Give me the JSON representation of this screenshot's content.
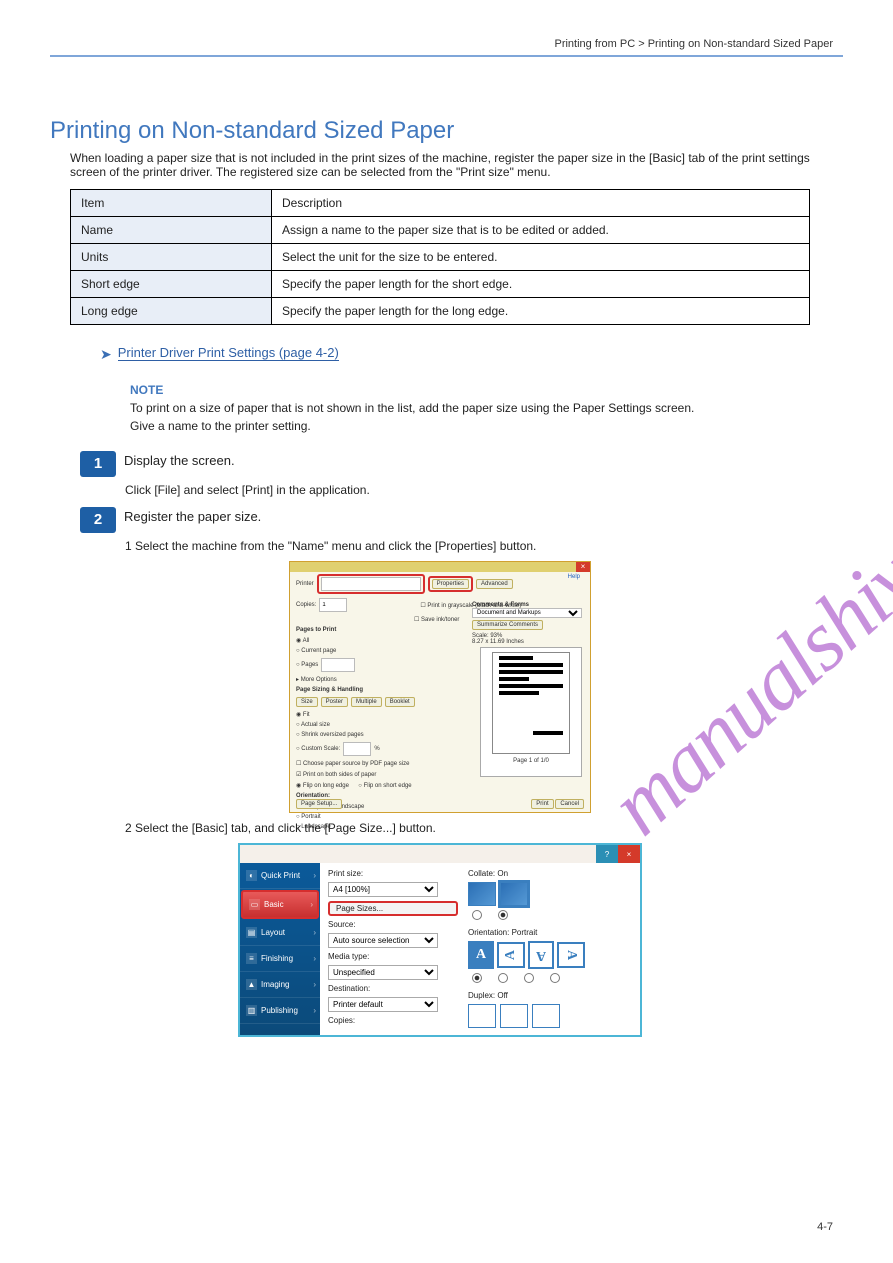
{
  "header_right": "Printing from PC > Printing on Non-standard Sized Paper",
  "page_number": "4-7",
  "title": "Printing on Non-standard Sized Paper",
  "subtitle": "When loading a paper size that is not included in the print sizes of the machine, register the paper size in the [Basic] tab of the print settings screen of the printer driver.\nThe registered size can be selected from the \"Print size\" menu.",
  "table": {
    "rows": [
      {
        "label": "Item",
        "value": "Description"
      },
      {
        "label": "Name",
        "value": "Assign a name to the paper size that is to be edited or added."
      },
      {
        "label": "Units",
        "value": "Select the unit for the size to be entered."
      },
      {
        "label": "Short edge",
        "value": "Specify the paper length for the short edge."
      },
      {
        "label": "Long edge",
        "value": "Specify the paper length for the long edge."
      }
    ]
  },
  "link": {
    "text": "Printer Driver Print Settings (page 4-2)"
  },
  "note": {
    "title": "NOTE",
    "l1": "To print on a size of paper that is not shown in the list, add the paper size using the Paper Settings screen.",
    "l2": "Give a name to the printer setting."
  },
  "steps": {
    "s1": {
      "text": "Display the screen."
    },
    "s1_sub": "Click [File] and select [Print] in the application.",
    "s2": {
      "text": "Register the paper size."
    },
    "s2_sub1": "1   Select the machine from the \"Name\" menu and click the [Properties] button.",
    "s2_sub2": "2   Select the [Basic] tab, and click the [Page Size...] button."
  },
  "dlg1": {
    "printer_lbl": "Printer",
    "copies_lbl": "Copies:",
    "properties": "Properties",
    "advanced": "Advanced",
    "help": "Help",
    "grayscale": "Print in grayscale (black-and-white)",
    "ink": "Save ink/toner",
    "pages_to_print": "Pages to Print",
    "all": "All",
    "current": "Current page",
    "pages": "Pages",
    "more_opts": "More Options",
    "sizing": "Page Sizing & Handling",
    "size": "Size",
    "poster": "Poster",
    "multiple": "Multiple",
    "booklet": "Booklet",
    "fit": "Fit",
    "actual": "Actual size",
    "shrink": "Shrink oversized pages",
    "custom": "Custom Scale:",
    "choosesrc": "Choose paper source by PDF page size",
    "both": "Print on both sides of paper",
    "fliplong": "Flip on long edge",
    "flipshort": "Flip on short edge",
    "orientation": "Orientation:",
    "autoport": "Auto portrait/landscape",
    "portrait": "Portrait",
    "landscape": "Landscape",
    "page_setup": "Page Setup...",
    "pageof": "Page 1 of 1/0",
    "print": "Print",
    "cancel": "Cancel",
    "comments": "Comments & Forms",
    "docmarkup": "Document and Markups",
    "summarize": "Summarize Comments",
    "scale": "Scale: 93%",
    "dims": "8.27 x 11.69 Inches"
  },
  "dlg2": {
    "tabs": [
      "Quick Print",
      "Basic",
      "Layout",
      "Finishing",
      "Imaging",
      "Publishing"
    ],
    "print_size": "Print size:",
    "a4": "A4  [100%]",
    "page_sizes": "Page Sizes...",
    "source": "Source:",
    "auto": "Auto source selection",
    "media": "Media type:",
    "unspec": "Unspecified",
    "dest": "Destination:",
    "pdefault": "Printer default",
    "copies": "Copies:",
    "collate": "Collate: On",
    "orient": "Orientation: Portrait",
    "duplex": "Duplex: Off"
  }
}
